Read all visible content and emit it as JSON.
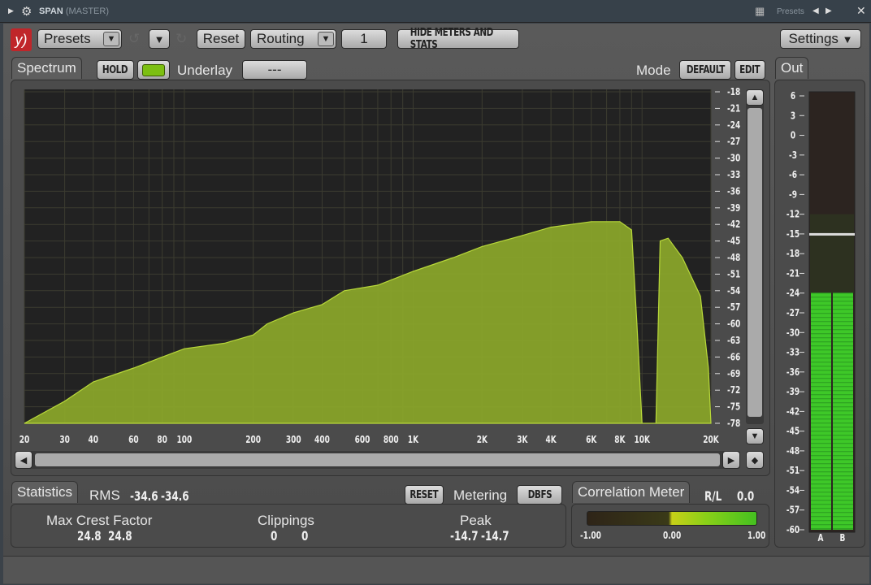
{
  "titlebar": {
    "plugin": "SPAN",
    "channel": "(MASTER)",
    "presets_label": "Presets"
  },
  "toolbar": {
    "presets": "Presets",
    "reset": "Reset",
    "routing": "Routing",
    "channel_num": "1",
    "hide_meters": "HIDE METERS AND STATS",
    "settings": "Settings"
  },
  "spectrum": {
    "tab": "Spectrum",
    "hold": "HOLD",
    "underlay_label": "Underlay",
    "underlay_value": "---",
    "mode_label": "Mode",
    "mode_value": "DEFAULT",
    "edit": "EDIT",
    "fill_color": "#8ca82a",
    "db_ticks": [
      "-18",
      "-21",
      "-24",
      "-27",
      "-30",
      "-33",
      "-36",
      "-39",
      "-42",
      "-45",
      "-48",
      "-51",
      "-54",
      "-57",
      "-60",
      "-63",
      "-66",
      "-69",
      "-72",
      "-75",
      "-78"
    ],
    "freq_ticks": [
      [
        "20",
        20
      ],
      [
        "30",
        30
      ],
      [
        "40",
        40
      ],
      [
        "60",
        60
      ],
      [
        "80",
        80
      ],
      [
        "100",
        100
      ],
      [
        "200",
        200
      ],
      [
        "300",
        300
      ],
      [
        "400",
        400
      ],
      [
        "600",
        600
      ],
      [
        "800",
        800
      ],
      [
        "1K",
        1000
      ],
      [
        "2K",
        2000
      ],
      [
        "3K",
        3000
      ],
      [
        "4K",
        4000
      ],
      [
        "6K",
        6000
      ],
      [
        "8K",
        8000
      ],
      [
        "10K",
        10000
      ],
      [
        "20K",
        20000
      ]
    ],
    "points": [
      [
        20,
        -78
      ],
      [
        30,
        -74
      ],
      [
        40,
        -70.5
      ],
      [
        60,
        -68
      ],
      [
        80,
        -66
      ],
      [
        100,
        -64.5
      ],
      [
        150,
        -63.5
      ],
      [
        200,
        -62
      ],
      [
        230,
        -60
      ],
      [
        300,
        -58
      ],
      [
        400,
        -56.5
      ],
      [
        500,
        -54
      ],
      [
        700,
        -53
      ],
      [
        1000,
        -50.5
      ],
      [
        1500,
        -48
      ],
      [
        2000,
        -46
      ],
      [
        3000,
        -44
      ],
      [
        4000,
        -42.5
      ],
      [
        6000,
        -41.5
      ],
      [
        8000,
        -41.5
      ],
      [
        9000,
        -43
      ],
      [
        9500,
        -60
      ],
      [
        10000,
        -78
      ],
      [
        11500,
        -78
      ],
      [
        12000,
        -45
      ],
      [
        13000,
        -44.5
      ],
      [
        15000,
        -48
      ],
      [
        18000,
        -55
      ],
      [
        19500,
        -68
      ],
      [
        20000,
        -78
      ]
    ]
  },
  "out": {
    "tab": "Out",
    "ticks": [
      "6",
      "3",
      "0",
      "-3",
      "-6",
      "-9",
      "-12",
      "-15",
      "-18",
      "-21",
      "-24",
      "-27",
      "-30",
      "-33",
      "-36",
      "-39",
      "-42",
      "-45",
      "-48",
      "-51",
      "-54",
      "-57",
      "-60"
    ],
    "level_db": -24,
    "peak_hold_db": -15,
    "channels": [
      "A",
      "B"
    ]
  },
  "stats": {
    "tab": "Statistics",
    "rms_label": "RMS",
    "rms": [
      "-34.6",
      "-34.6"
    ],
    "reset": "RESET",
    "metering_label": "Metering",
    "metering_value": "DBFS",
    "crest_label": "Max Crest Factor",
    "crest": [
      "24.8",
      "24.8"
    ],
    "clip_label": "Clippings",
    "clip": [
      "0",
      "0"
    ],
    "peak_label": "Peak",
    "peak": [
      "-14.7",
      "-14.7"
    ]
  },
  "correlation": {
    "tab": "Correlation Meter",
    "rl_label": "R/L",
    "rl_value": "0.0",
    "min": "-1.00",
    "mid": "0.00",
    "max": "1.00",
    "value": 0.0
  }
}
